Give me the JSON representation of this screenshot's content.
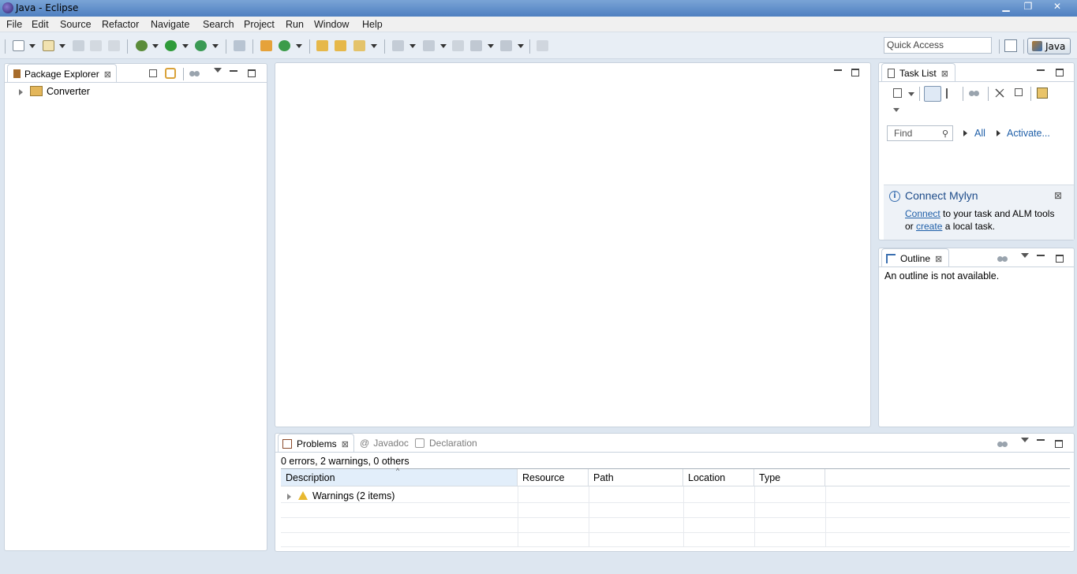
{
  "window": {
    "title": "Java - Eclipse"
  },
  "menu": [
    "File",
    "Edit",
    "Source",
    "Refactor",
    "Navigate",
    "Search",
    "Project",
    "Run",
    "Window",
    "Help"
  ],
  "toolbar": {
    "quick_access_placeholder": "Quick Access",
    "perspective_label": "Java"
  },
  "package_explorer": {
    "tab_label": "Package Explorer",
    "close_glyph": "☒",
    "tree": [
      {
        "label": "Converter"
      }
    ]
  },
  "task_list": {
    "tab_label": "Task List",
    "find_placeholder": "Find",
    "all_label": "All",
    "activate_label": "Activate...",
    "mylyn": {
      "title": "Connect Mylyn",
      "connect_link": "Connect",
      "text1": " to your task and ALM tools",
      "text2": "or ",
      "create_link": "create",
      "text3": " a local task."
    }
  },
  "outline": {
    "tab_label": "Outline",
    "message": "An outline is not available."
  },
  "problems": {
    "tabs": [
      "Problems",
      "Javadoc",
      "Declaration"
    ],
    "summary": "0 errors, 2 warnings, 0 others",
    "columns": [
      "Description",
      "Resource",
      "Path",
      "Location",
      "Type"
    ],
    "rows": [
      {
        "description": "Warnings (2 items)"
      }
    ]
  }
}
